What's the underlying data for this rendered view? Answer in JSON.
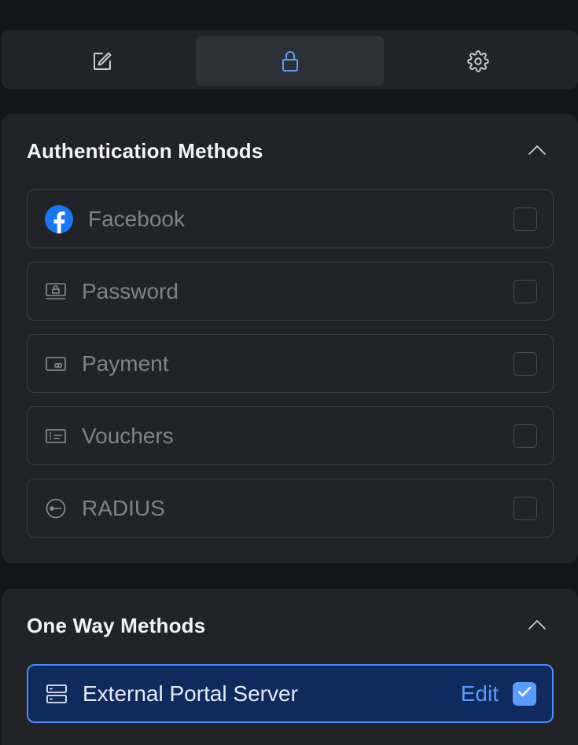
{
  "tabs": [
    {
      "name": "edit",
      "icon": "edit-icon",
      "active": false
    },
    {
      "name": "security",
      "icon": "lock-icon",
      "active": true
    },
    {
      "name": "settings",
      "icon": "gear-icon",
      "active": false
    }
  ],
  "auth_section": {
    "title": "Authentication Methods",
    "collapse_icon": "chevron-up-icon",
    "methods": [
      {
        "label": "Facebook",
        "icon": "facebook-icon",
        "checked": false
      },
      {
        "label": "Password",
        "icon": "password-icon",
        "checked": false
      },
      {
        "label": "Payment",
        "icon": "payment-icon",
        "checked": false
      },
      {
        "label": "Vouchers",
        "icon": "voucher-icon",
        "checked": false
      },
      {
        "label": "RADIUS",
        "icon": "radius-icon",
        "checked": false
      }
    ]
  },
  "oneway_section": {
    "title": "One Way Methods",
    "collapse_icon": "chevron-up-icon",
    "methods": [
      {
        "label": "External Portal Server",
        "icon": "server-icon",
        "edit_label": "Edit",
        "checked": true
      }
    ]
  },
  "colors": {
    "accent": "#5b9bff",
    "selected_bg": "#0f2a5c",
    "card_bg": "#212327",
    "page_bg": "#141518",
    "facebook": "#1877f2"
  }
}
